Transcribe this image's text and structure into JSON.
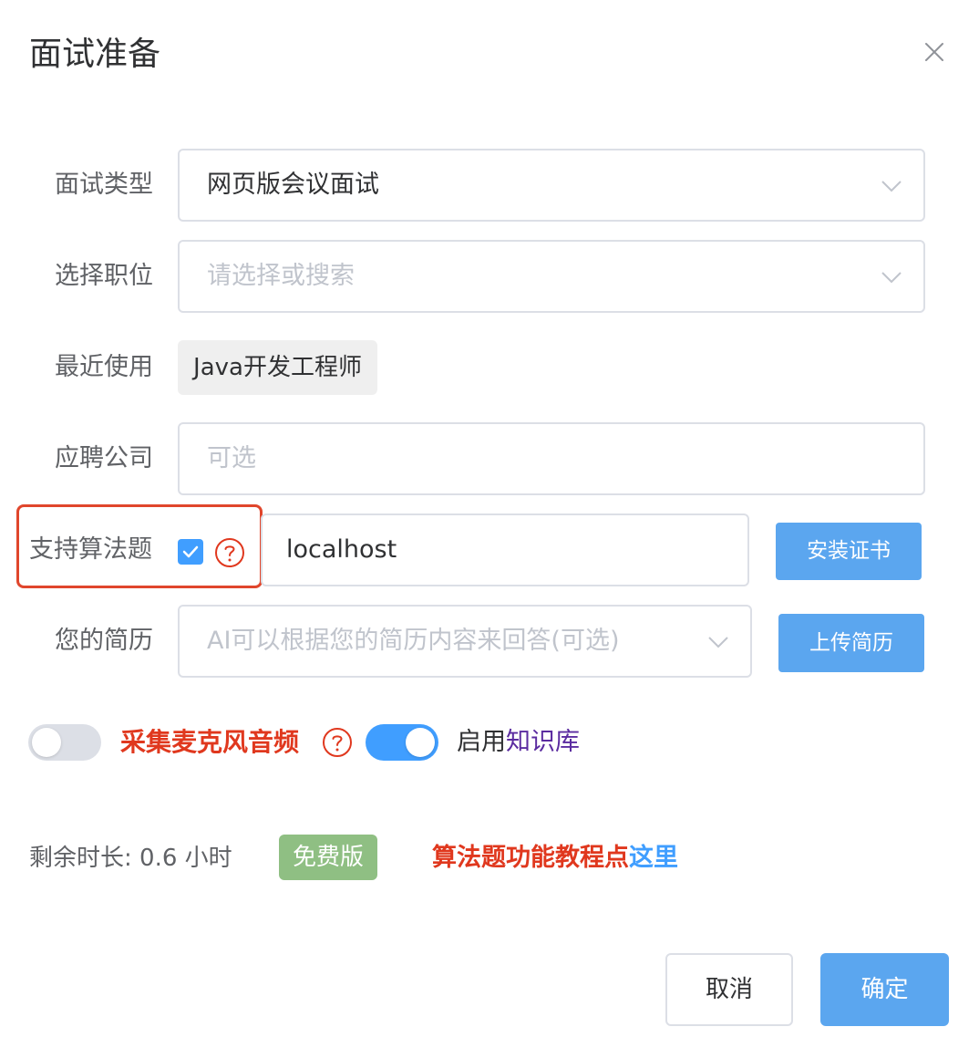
{
  "dialog": {
    "title": "面试准备"
  },
  "form": {
    "interview_type": {
      "label": "面试类型",
      "value": "网页版会议面试"
    },
    "position": {
      "label": "选择职位",
      "placeholder": "请选择或搜索"
    },
    "recent": {
      "label": "最近使用",
      "chip": "Java开发工程师"
    },
    "company": {
      "label": "应聘公司",
      "placeholder": "可选"
    },
    "algorithm": {
      "label": "支持算法题",
      "checked": true,
      "host_value": "localhost",
      "install_button": "安装证书"
    },
    "resume": {
      "label": "您的简历",
      "placeholder": "AI可以根据您的简历内容来回答(可选)",
      "upload_button": "上传简历"
    }
  },
  "toggles": {
    "mic": {
      "label": "采集麦克风音频",
      "on": false
    },
    "knowledge": {
      "prefix": "启用",
      "link": "知识库",
      "on": true
    }
  },
  "footer_info": {
    "remaining": "剩余时长: 0.6 小时",
    "badge": "免费版",
    "tutorial_text": "算法题功能教程点",
    "tutorial_link": "这里"
  },
  "actions": {
    "cancel": "取消",
    "confirm": "确定"
  },
  "colors": {
    "primary": "#409eff",
    "button_blue": "#5ba6ef",
    "danger_red": "#e0381e",
    "badge_green": "#8fbf83",
    "knowledge_link": "#5b2ca0"
  }
}
